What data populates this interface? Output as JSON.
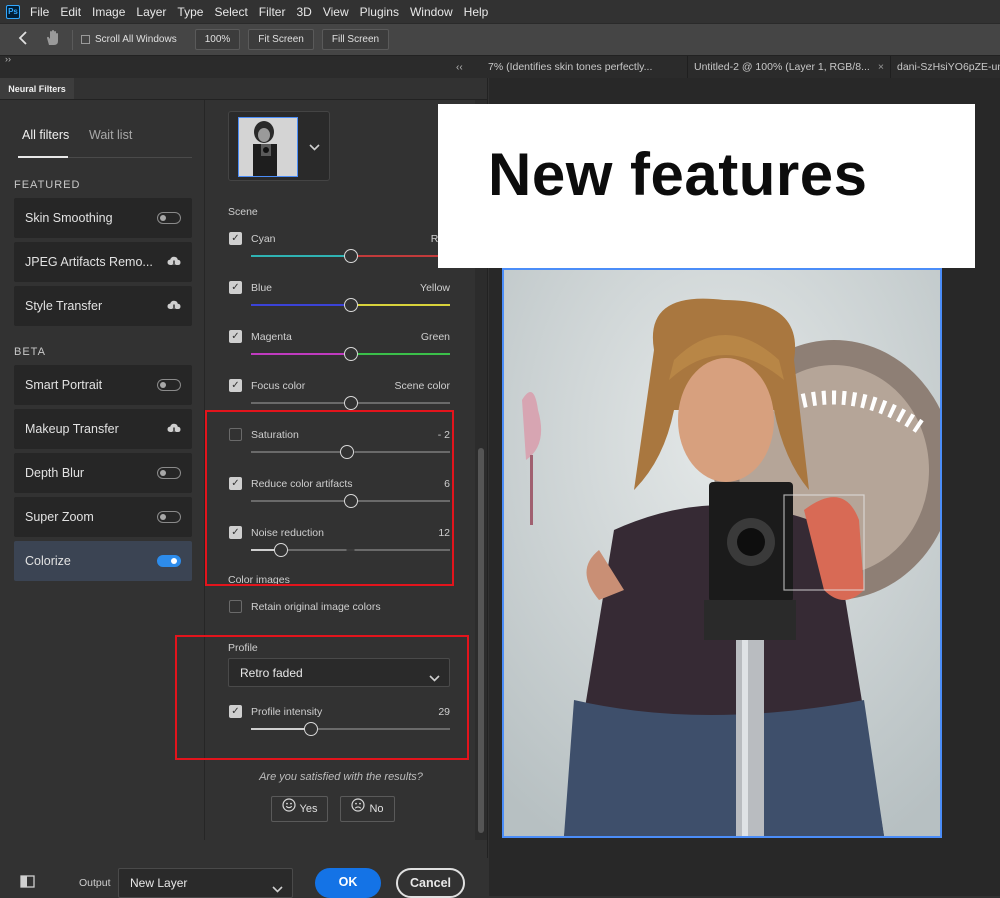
{
  "menubar": {
    "logo": "Ps",
    "items": [
      "File",
      "Edit",
      "Image",
      "Layer",
      "Type",
      "Select",
      "Filter",
      "3D",
      "View",
      "Plugins",
      "Window",
      "Help"
    ]
  },
  "optionsbar": {
    "scroll_all": "Scroll All Windows",
    "zoom_100": "100%",
    "fit_screen": "Fit Screen",
    "fill_screen": "Fill Screen"
  },
  "doc_tabs": [
    {
      "label": "7% (Identifies skin tones perfectly..."
    },
    {
      "label": "Untitled-2 @ 100% (Layer 1, RGB/8..."
    },
    {
      "label": "dani-SzHsiYO6pZE-un"
    }
  ],
  "panel": {
    "title": "Neural Filters",
    "tab_all": "All filters",
    "tab_wait": "Wait list",
    "featured_header": "FEATURED",
    "beta_header": "BETA",
    "featured": [
      {
        "label": "Skin Smoothing",
        "control": "toggle"
      },
      {
        "label": "JPEG Artifacts Remo...",
        "control": "cloud"
      },
      {
        "label": "Style Transfer",
        "control": "cloud"
      }
    ],
    "beta": [
      {
        "label": "Smart Portrait",
        "control": "toggle"
      },
      {
        "label": "Makeup Transfer",
        "control": "cloud"
      },
      {
        "label": "Depth Blur",
        "control": "toggle"
      },
      {
        "label": "Super Zoom",
        "control": "toggle"
      },
      {
        "label": "Colorize",
        "control": "toggle-on"
      }
    ]
  },
  "settings": {
    "scene_label": "Scene",
    "color_images_label": "Color images",
    "retain_label": "Retain original image colors",
    "profile_label": "Profile",
    "profile_value": "Retro faded",
    "satisfied_q": "Are you satisfied with the results?",
    "yes": "Yes",
    "no": "No",
    "sliders": [
      {
        "left": "Cyan",
        "right": "Red",
        "value": 0.5,
        "checked": true,
        "gradient": [
          "#2fb3b3",
          "#c23b3b"
        ]
      },
      {
        "left": "Blue",
        "right": "Yellow",
        "value": 0.5,
        "checked": true,
        "gradient": [
          "#3b43d8",
          "#d8d23b"
        ]
      },
      {
        "left": "Magenta",
        "right": "Green",
        "value": 0.5,
        "checked": true,
        "gradient": [
          "#c03bc0",
          "#3bc04a"
        ]
      },
      {
        "left": "Focus color",
        "right": "Scene color",
        "value": 0.5,
        "checked": true,
        "gradient": [
          "#6a6a6a",
          "#6a6a6a"
        ]
      },
      {
        "left": "Saturation",
        "right": "- 2",
        "value": 0.48,
        "checked": false,
        "gradient": [
          "#6a6a6a",
          "#6a6a6a"
        ]
      },
      {
        "left": "Reduce color artifacts",
        "right": "6",
        "value": 0.5,
        "checked": true,
        "gradient": [
          "#6a6a6a",
          "#6a6a6a"
        ]
      },
      {
        "left": "Noise reduction",
        "right": "12",
        "value": 0.15,
        "checked": true,
        "gradient": [
          "#6a6a6a",
          "#6a6a6a"
        ]
      }
    ],
    "profile_intensity": {
      "label": "Profile intensity",
      "value_text": "29",
      "value": 0.3
    }
  },
  "footer": {
    "output_label": "Output",
    "output_value": "New Layer",
    "ok": "OK",
    "cancel": "Cancel"
  },
  "badge": {
    "text": "New features"
  },
  "colors": {
    "accent": "#2d8ceb",
    "highlight_red": "#e3141c",
    "selection_blue": "#4b8df8"
  }
}
